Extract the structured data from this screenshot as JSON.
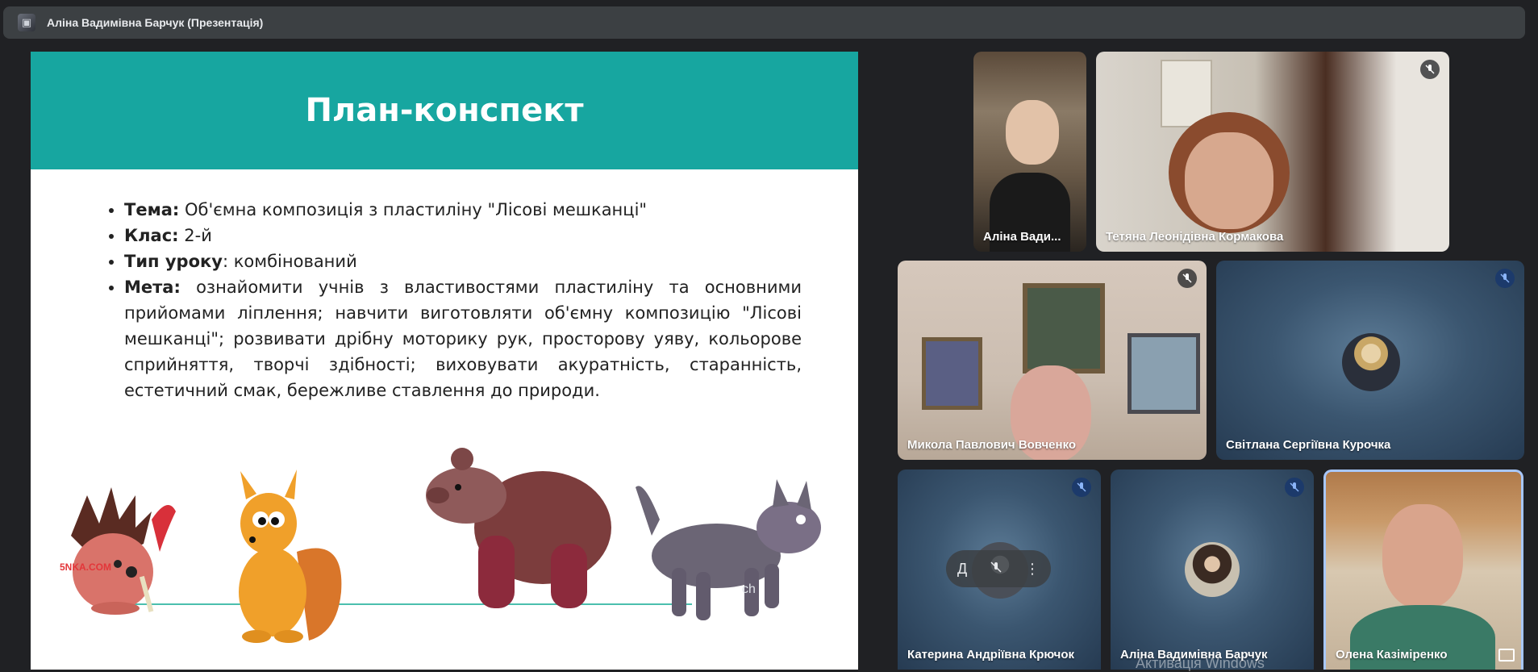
{
  "topbar": {
    "title": "Аліна Вадимівна Барчук (Презентація)"
  },
  "slide": {
    "title": "План-конспект",
    "items": [
      {
        "label": "Тема:",
        "text": " Об'ємна композиція з пластиліну \"Лісові мешканці\""
      },
      {
        "label": "Клас:",
        "text": " 2-й"
      },
      {
        "label": "Тип уроку",
        "text": ": комбінований"
      },
      {
        "label": "Мета:",
        "text": " ознайомити учнів з властивостями пластиліну та основними прийомами ліплення; навчити виготовляти об'ємну композицію \"Лісові мешканці\"; розвивати дрібну моторику рук, просторову уяву, кольорове сприйняття, творчі здібності; виховувати акуратність, старанність, естетичний смак, бережливе ставлення до природи."
      }
    ],
    "watermark_small": "5NKA.COM",
    "watermark_wolf": "ch"
  },
  "participants": [
    {
      "name": "Аліна Вади...",
      "muted": false
    },
    {
      "name": "Тетяна Леонідівна Кормакова",
      "muted": true
    },
    {
      "name": "Микола Павлович Вовченко",
      "muted": true
    },
    {
      "name": "Світлана Сергіївна Курочка",
      "muted": true
    },
    {
      "name": "Катерина Андріївна Крючок",
      "muted": true
    },
    {
      "name": "Аліна Вадимівна Барчук",
      "muted": true
    },
    {
      "name": "Олена Казіміренко",
      "muted": false
    }
  ],
  "pill": {
    "first": "Д"
  },
  "system": {
    "activation_watermark": "Активація Windows"
  },
  "colors": {
    "slide_header": "#17a6a0",
    "background": "#202124",
    "tile_blue": "#3b5670",
    "active_border": "#a8c7fa"
  }
}
